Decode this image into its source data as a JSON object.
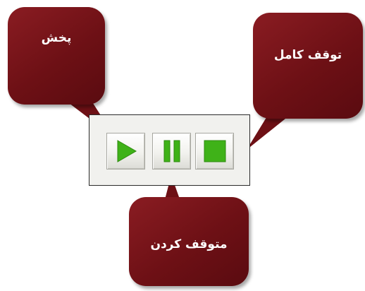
{
  "callouts": {
    "play": "پخش",
    "stop": "توقف کامل",
    "pause": "متوقف کردن"
  },
  "controls": [
    {
      "id": "play",
      "icon": "play-icon"
    },
    {
      "id": "pause",
      "icon": "pause-icon"
    },
    {
      "id": "stop",
      "icon": "stop-icon"
    }
  ],
  "colors": {
    "callout": "#6d1015",
    "icon_green": "#3fb218",
    "toolbar_bg": "#f1f1ee",
    "toolbar_border": "#2b2b2b"
  }
}
